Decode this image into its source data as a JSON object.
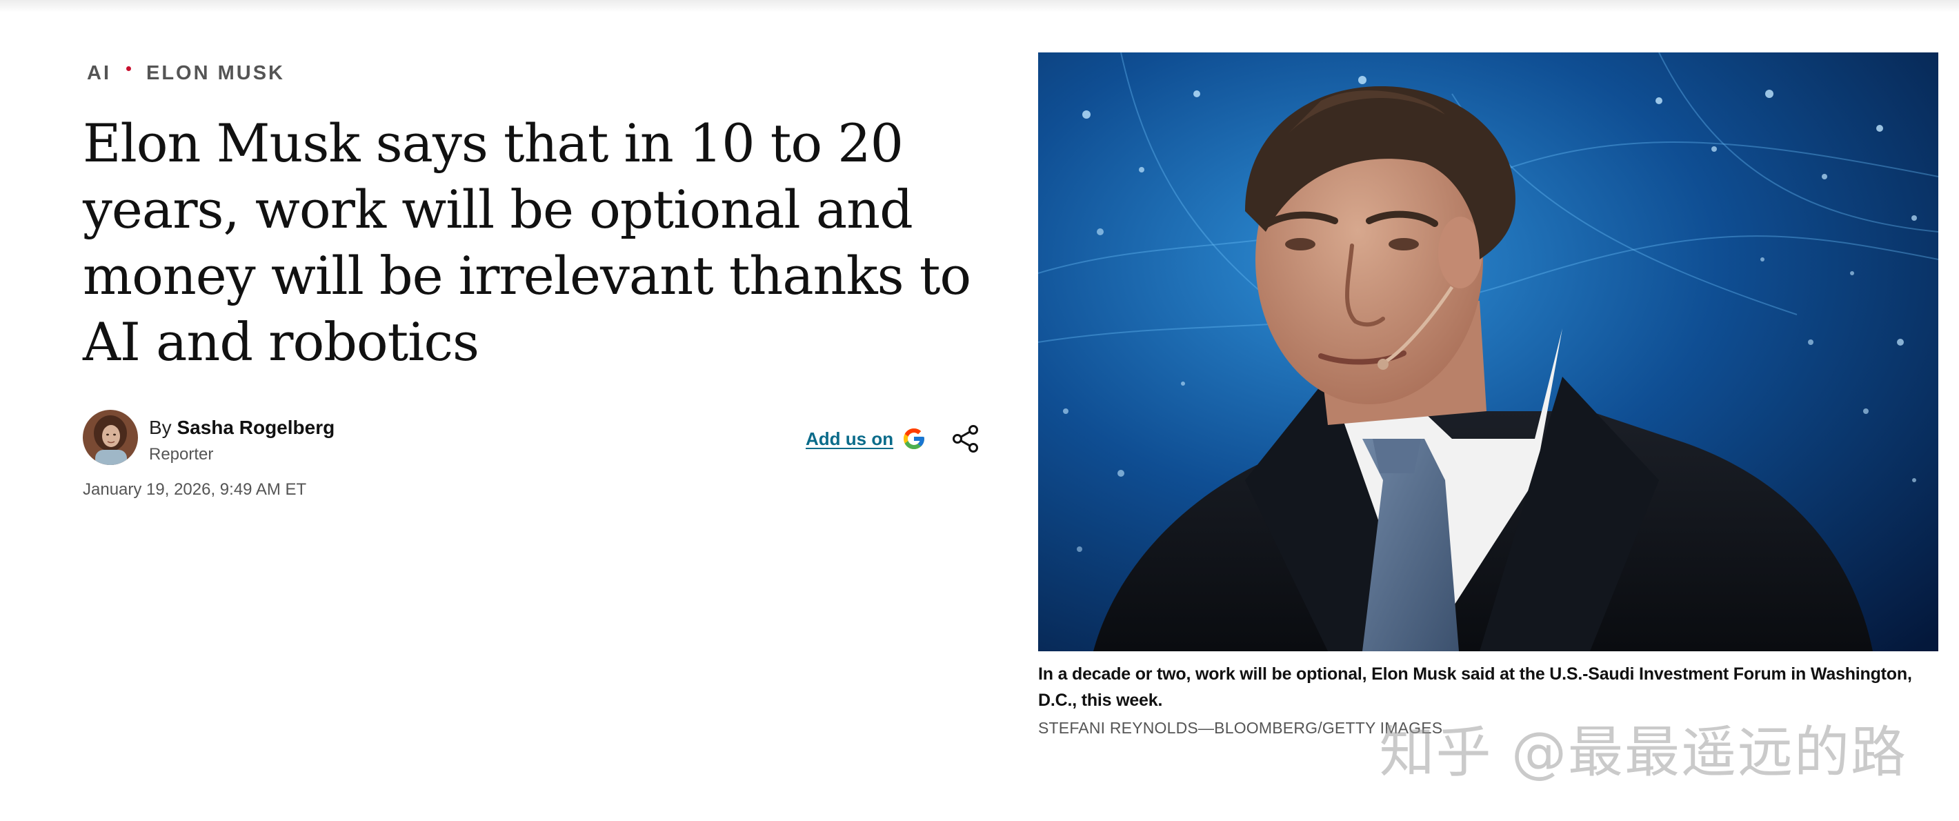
{
  "section": {
    "tags": [
      "AI",
      "ELON MUSK"
    ],
    "dot_color": "#c8102e"
  },
  "article": {
    "headline": "Elon Musk says that in 10 to 20 years, work will be optional and money will be irrelevant thanks to AI and robotics",
    "byline_prefix": "By",
    "author": "Sasha Rogelberg",
    "role": "Reporter",
    "date": "January 19, 2026, 9:49 AM ET"
  },
  "actions": {
    "add_us_label": "Add us on",
    "add_us_icon": "google-icon",
    "share_icon": "share-icon"
  },
  "figure": {
    "caption": "In a decade or two, work will be optional, Elon Musk said at the U.S.-Saudi Investment Forum in Washington, D.C., this week.",
    "credit": "STEFANI REYNOLDS—BLOOMBERG/GETTY IMAGES"
  },
  "watermark": {
    "text": "知乎 @最最遥远的路"
  },
  "colors": {
    "link": "#0a6b8a",
    "text": "#111111",
    "muted": "#555555",
    "accent_dot": "#c8102e"
  }
}
